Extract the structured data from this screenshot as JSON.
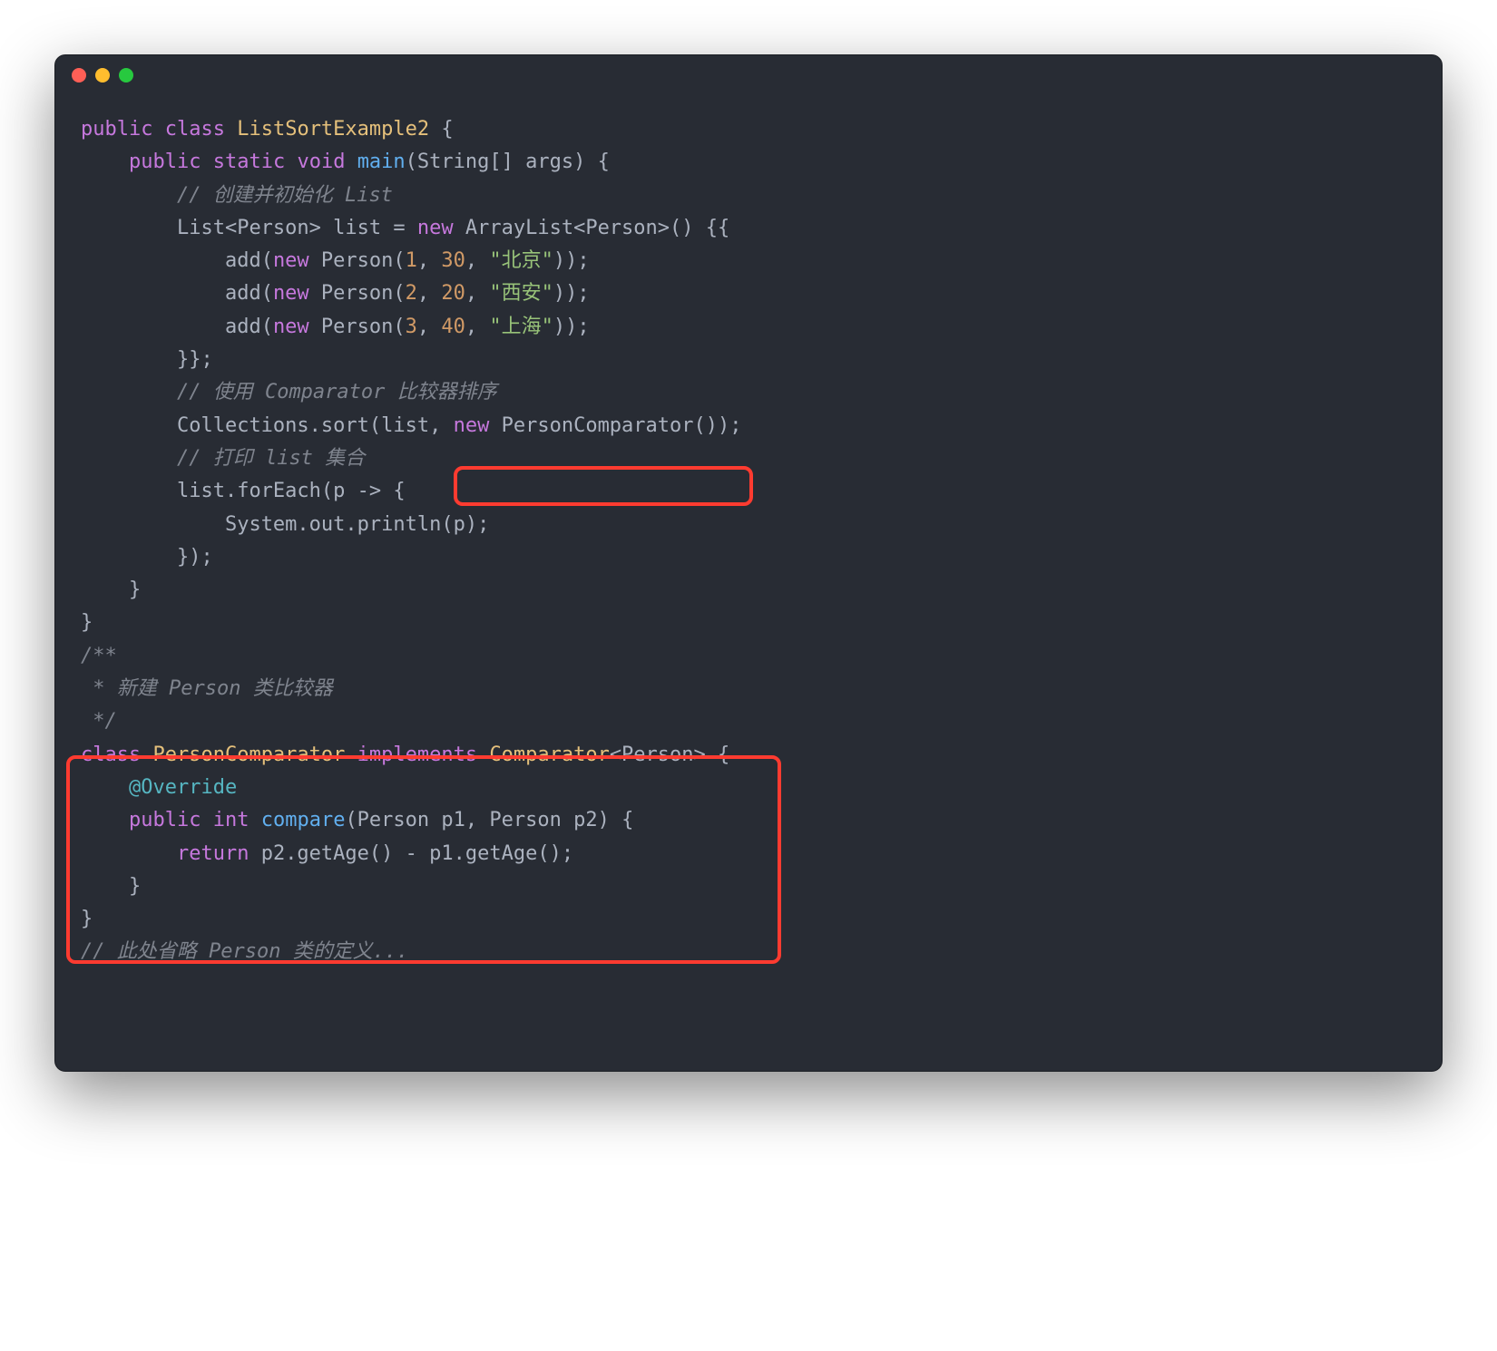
{
  "code": {
    "l1": {
      "kw1": "public",
      "kw2": "class",
      "cls": "ListSortExample2",
      "brace": " {"
    },
    "l2": {
      "kw1": "public",
      "kw2": "static",
      "kw3": "void",
      "fn": "main",
      "sig": "(String[] args) {"
    },
    "l3": {
      "com": "// 创建并初始化 List"
    },
    "l4": {
      "a": "List<Person> list = ",
      "kw": "new",
      "b": " ArrayList<Person>() {{"
    },
    "l5": {
      "a": "add(",
      "kw": "new",
      "b": " Person(",
      "n1": "1",
      "c": ", ",
      "n2": "30",
      "d": ", ",
      "s": "\"北京\"",
      "e": "));"
    },
    "l6": {
      "a": "add(",
      "kw": "new",
      "b": " Person(",
      "n1": "2",
      "c": ", ",
      "n2": "20",
      "d": ", ",
      "s": "\"西安\"",
      "e": "));"
    },
    "l7": {
      "a": "add(",
      "kw": "new",
      "b": " Person(",
      "n1": "3",
      "c": ", ",
      "n2": "40",
      "d": ", ",
      "s": "\"上海\"",
      "e": "));"
    },
    "l8": {
      "a": "}};"
    },
    "l9": {
      "com": "// 使用 Comparator 比较器排序"
    },
    "l10": {
      "a": "Collections.sort(list, ",
      "kw": "new",
      "b": " PersonComparator());"
    },
    "l11": {
      "com": "// 打印 list 集合"
    },
    "l12": {
      "a": "list.forEach(p -> {"
    },
    "l13": {
      "a": "System.out.println(p);"
    },
    "l14": {
      "a": "});"
    },
    "l15": {
      "a": "}"
    },
    "l16": {
      "a": "}"
    },
    "l17": {
      "com": "/**"
    },
    "l18": {
      "com": " * 新建 Person 类比较器"
    },
    "l19": {
      "com": " */"
    },
    "l20": {
      "kw": "class",
      "cls": "PersonComparator",
      "impl": "implements",
      "iface": "Comparator",
      "gen": "<Person> {"
    },
    "l21": {
      "ann": "@Override"
    },
    "l22": {
      "kw1": "public",
      "kw2": "int",
      "fn": "compare",
      "sig": "(Person p1, Person p2) {"
    },
    "l23": {
      "kw": "return",
      "a": " p2.getAge() - p1.getAge();"
    },
    "l24": {
      "a": "}"
    },
    "l25": {
      "a": "}"
    },
    "l26": {
      "com": "// 此处省略 Person 类的定义..."
    }
  },
  "highlights": {
    "box1_desc": "new PersonComparator()",
    "box2_desc": "PersonComparator class definition"
  }
}
